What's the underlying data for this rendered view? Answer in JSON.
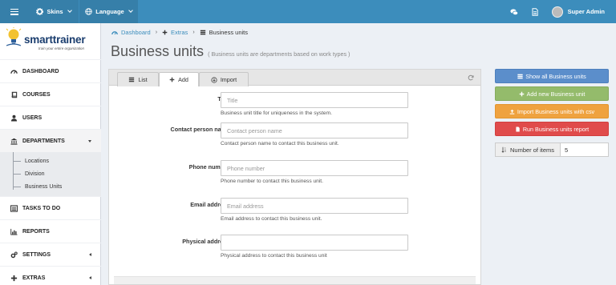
{
  "topbar": {
    "skins_label": "Skins",
    "language_label": "Language",
    "user_name": "Super Admin",
    "color": "#3c8dbc"
  },
  "logo": {
    "brand": "smarttrainer",
    "tagline": "train your entire organization"
  },
  "sidebar": {
    "items": [
      {
        "label": "DASHBOARD",
        "icon": "dashboard-icon"
      },
      {
        "label": "COURSES",
        "icon": "book-icon"
      },
      {
        "label": "USERS",
        "icon": "user-icon"
      },
      {
        "label": "DEPARTMENTS",
        "icon": "bank-icon"
      },
      {
        "label": "TASKS TO DO",
        "icon": "list-icon"
      },
      {
        "label": "REPORTS",
        "icon": "bar-chart-icon"
      },
      {
        "label": "SETTINGS",
        "icon": "cogs-icon"
      },
      {
        "label": "EXTRAS",
        "icon": "plus-icon"
      }
    ],
    "departments_sub": [
      "Locations",
      "Division",
      "Business Units"
    ]
  },
  "breadcrumb": {
    "home": "Dashboard",
    "extras": "Extras",
    "current": "Business units"
  },
  "page": {
    "title": "Business units",
    "subtitle": "( Business units are departments based on work types )"
  },
  "tabs": {
    "list": "List",
    "add": "Add",
    "import": "Import"
  },
  "form": {
    "title": {
      "label": "Title",
      "placeholder": "Title",
      "help": "Business unit title for uniqueness in the system."
    },
    "contact": {
      "label": "Contact person name",
      "placeholder": "Contact person name",
      "help": "Contact person name to contact this business unit."
    },
    "phone": {
      "label": "Phone number",
      "placeholder": "Phone number",
      "help": "Phone number to contact this business unit."
    },
    "email": {
      "label": "Email address",
      "placeholder": "Email address",
      "help": "Email address to contact this business unit."
    },
    "address": {
      "label": "Physical address",
      "placeholder": "",
      "help": "Physical address to contact this business unit"
    }
  },
  "actions": {
    "show_all": "Show all Business units",
    "add_new": "Add new Business unit",
    "import_csv": "Import Business units with csv",
    "run_report": "Run Business units report",
    "number_of_items_label": "Number of items",
    "number_of_items_value": "5"
  }
}
